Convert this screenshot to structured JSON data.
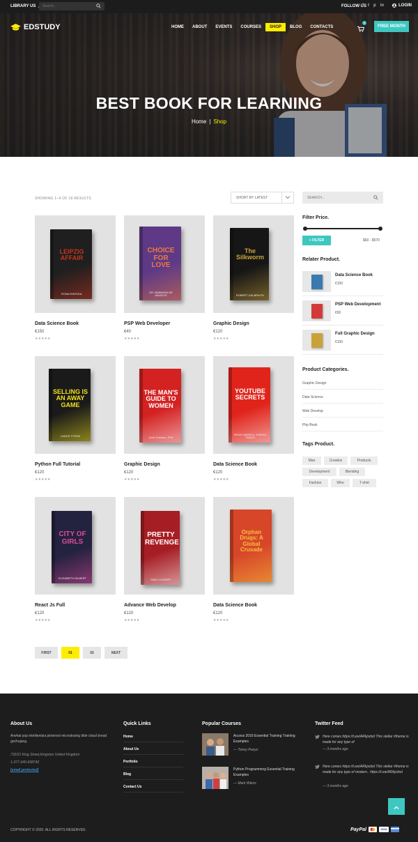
{
  "topbar": {
    "library_label": "LIBRARY US",
    "search_placeholder": "Search...",
    "follow_label": "FOLLOW US",
    "socials": [
      "f",
      "t",
      "p",
      "in"
    ],
    "login_label": "LOGIN"
  },
  "header": {
    "logo_text": "EDSTUDY",
    "nav": [
      "HOME",
      "ABOUT",
      "EVENTS",
      "COURSES",
      "SHOP",
      "BLOG",
      "CONTACTS"
    ],
    "active_nav": "SHOP",
    "cart_count": "0",
    "free_button": "FREE MONTH"
  },
  "hero": {
    "title": "BEST BOOK FOR LEARNING",
    "crumb_home": "Home",
    "crumb_sep": "|",
    "crumb_current": "Shop"
  },
  "toolbar": {
    "showing": "SHOWING 1–4 OF 18 RESULTS",
    "sort_label": "SHORT BY LATEST"
  },
  "products": [
    {
      "name": "Data Science Book",
      "price": "€150",
      "stars": "★★★★★",
      "cover": {
        "bg": "#1f1f1f",
        "accent": "#c4341f",
        "title": "LEIPZIG AFFAIR",
        "author": "FIONA RINTOUL"
      }
    },
    {
      "name": "PSP Web Developer",
      "price": "€40",
      "stars": "★★★★★",
      "cover": {
        "bg": "#5e3a86",
        "accent": "#f0793b",
        "title": "CHOICE FOR LOVE",
        "author": "DR. BARBARA DE ANGELIS"
      }
    },
    {
      "name": "Graphic Design",
      "price": "€120",
      "stars": "★★★★★",
      "cover": {
        "bg": "#161616",
        "accent": "#c9a33a",
        "title": "The Silkworm",
        "author": "ROBERT GALBRAITH"
      }
    },
    {
      "name": "Python Full Tutorial",
      "price": "€120",
      "stars": "★★★★★",
      "cover": {
        "bg": "#1a1a1a",
        "accent": "#f2e21a",
        "title": "SELLING IS AN AWAY GAME",
        "author": "LANCE TYSON"
      }
    },
    {
      "name": "Graphic Design",
      "price": "€120",
      "stars": "★★★★★",
      "cover": {
        "bg": "#d42121",
        "accent": "#ffffff",
        "title": "THE MAN'S GUIDE TO WOMEN",
        "author": "John Gottman, PhD"
      }
    },
    {
      "name": "Data Science Book",
      "price": "€120",
      "stars": "★★★★★",
      "cover": {
        "bg": "#e0241b",
        "accent": "#ffffff",
        "title": "YOUTUBE SECRETS",
        "author": "SEAN CANNELL & BENJI TRAVIS"
      }
    },
    {
      "name": "React Js Full",
      "price": "€120",
      "stars": "★★★★★",
      "cover": {
        "bg": "#23223f",
        "accent": "#e14a9a",
        "title": "CITY OF GIRLS",
        "author": "ELIZABETH GILBERT"
      }
    },
    {
      "name": "Advance Web Develop",
      "price": "€120",
      "stars": "★★★★★",
      "cover": {
        "bg": "#a61e24",
        "accent": "#ffffff",
        "title": "PRETTY REVENGE",
        "author": "EMILY LIEBERT"
      }
    },
    {
      "name": "Data Science Book",
      "price": "€120",
      "stars": "★★★★★",
      "cover": {
        "bg": "#d8462a",
        "accent": "#f5c23a",
        "title": "Orphan Drugs: A Global Crusade",
        "author": ""
      }
    }
  ],
  "pager": [
    "FIRST",
    "01",
    "02",
    "NEXT"
  ],
  "pager_active": "01",
  "sidebar": {
    "search_placeholder": "SEARCH...",
    "filter_title": "Filter Price.",
    "filter_button": "+ FILTER",
    "range": "$60 - $570",
    "price_range_handles": [
      0.0,
      1.0
    ],
    "related_title": "Relater Product.",
    "related": [
      {
        "name": "Data Science Book",
        "price": "€150"
      },
      {
        "name": "PSP Web Development",
        "price": "€60"
      },
      {
        "name": "Full Graphic Design",
        "price": "€150"
      }
    ],
    "categories_title": "Product Categories.",
    "categories": [
      "Graphic Design",
      "Data Science",
      "Web Develop",
      "Php Book"
    ],
    "tags_title": "Tags Product.",
    "tags": [
      "Man",
      "Creative",
      "Products",
      "Development",
      "Blending",
      "Fashion",
      "Who",
      "T-shirt"
    ]
  },
  "footer": {
    "about_title": "About Us",
    "about_text": "Arwhal pop intellientsia pinterest microdosing tilde cloud bread gochujang.",
    "address": "732/21 King Street,Kingston United Kingdom",
    "phone": "1-377-245-658742",
    "email": "[email protected]",
    "quick_title": "Quick Links",
    "quick_links": [
      "Home",
      "About Us",
      "Portfolio",
      "Blog",
      "Contact Us"
    ],
    "popular_title": "Popular Courses",
    "popular": [
      {
        "title": "Access 2016 Essential Training Training Examples",
        "author": "—   Tonoy Pueyo"
      },
      {
        "title": "Python Programming Essential Training Examples",
        "author": "—   Mark Wiens"
      }
    ],
    "twitter_title": "Twitter Feed",
    "tweets": [
      {
        "text": "Here comes https://t.ew/ARkjsdsd This stellar #theme is made for any type of",
        "time": "—   3 months ago"
      },
      {
        "text": "Here comes https://t.ew/ARkjsdsd This stellar #theme is made for any type of modern.. https://t.ew/ARkjsdsd",
        "time": "—   3 months ago"
      }
    ],
    "copyright": "COPYRIGHT © 2020. ALL RIGHTS RESERVED.",
    "paypal": "PayPal",
    "visa": "VISA"
  },
  "colors": {
    "accent_teal": "#3ec7c1",
    "accent_yellow": "#ffed00",
    "dark": "#1d1d1d"
  }
}
